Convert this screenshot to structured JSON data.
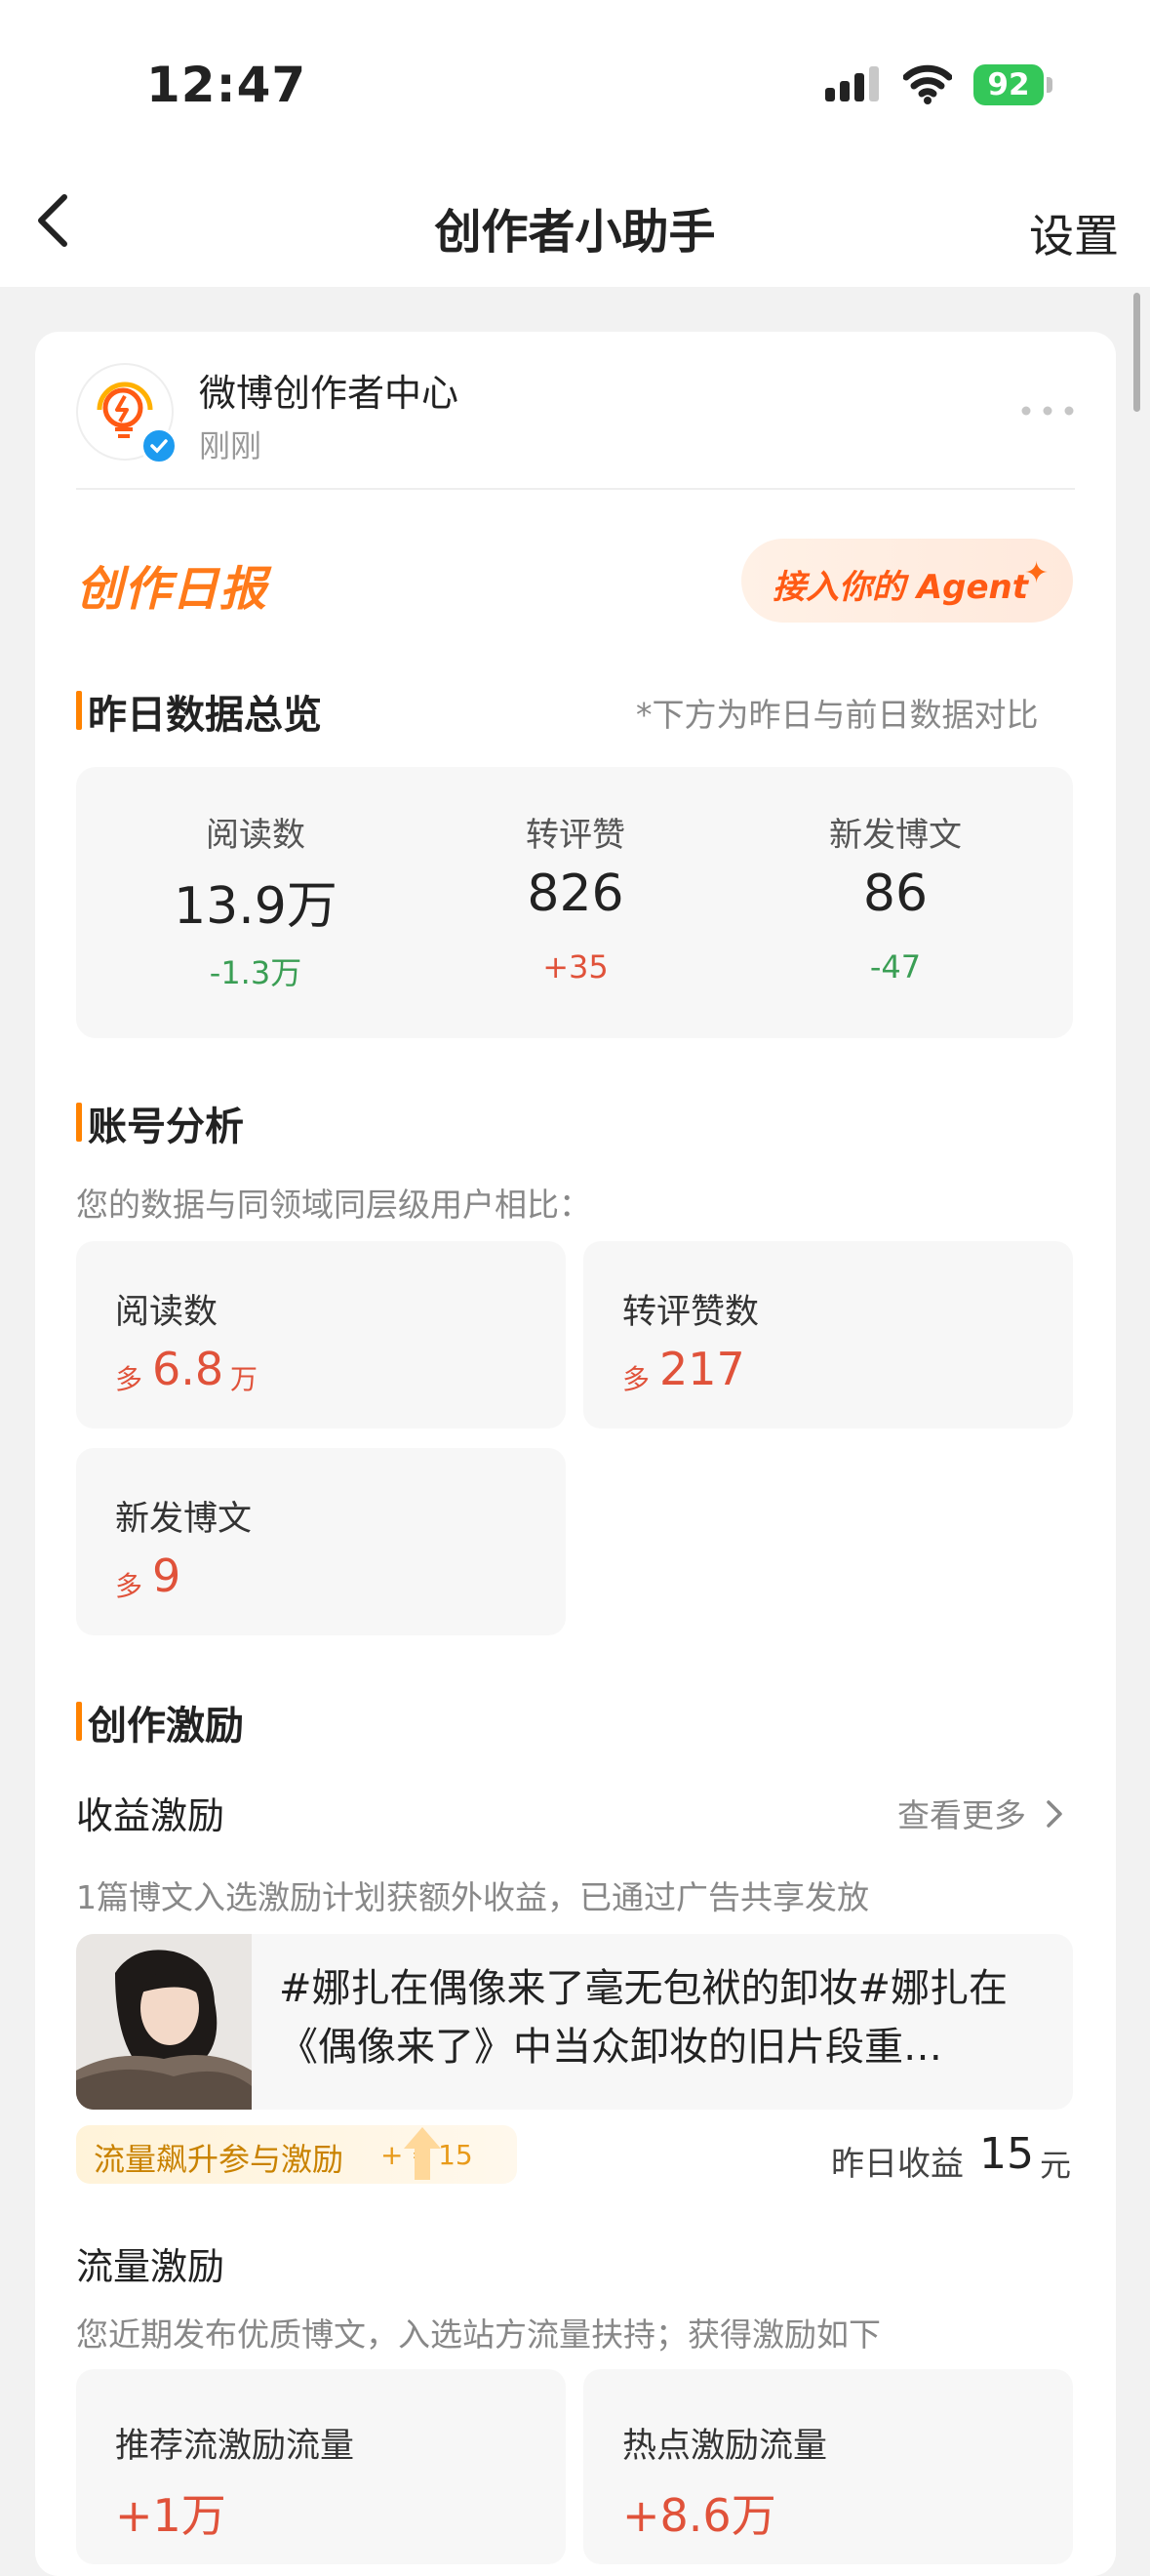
{
  "status_bar": {
    "time": "12:47",
    "battery": "92"
  },
  "nav": {
    "title": "创作者小助手",
    "settings": "设置"
  },
  "account": {
    "name": "微博创作者中心",
    "time": "刚刚"
  },
  "daily": {
    "title": "创作日报",
    "agent_button": "接入你的 Agent"
  },
  "overview": {
    "title": "昨日数据总览",
    "note": "*下方为昨日与前日数据对比",
    "items": [
      {
        "label": "阅读数",
        "value": "13.9万",
        "delta": "-1.3万"
      },
      {
        "label": "转评赞",
        "value": "826",
        "delta": "+35"
      },
      {
        "label": "新发博文",
        "value": "86",
        "delta": "-47"
      }
    ]
  },
  "analysis": {
    "title": "账号分析",
    "subtitle": "您的数据与同领域同层级用户相比：",
    "prefix": "多",
    "items": [
      {
        "label": "阅读数",
        "value": "6.8",
        "unit": "万"
      },
      {
        "label": "转评赞数",
        "value": "217",
        "unit": ""
      },
      {
        "label": "新发博文",
        "value": "9",
        "unit": ""
      }
    ]
  },
  "incentive": {
    "title": "创作激励",
    "revenue": {
      "title": "收益激励",
      "see_more": "查看更多",
      "desc": "1篇博文入选激励计划获额外收益，已通过广告共享发放",
      "post_text": "#娜扎在偶像来了毫无包袱的卸妆#娜扎在《偶像来了》中当众卸妆的旧片段重…",
      "tag": "流量飙升参与激励",
      "tag_bonus": "+ ¥ 15",
      "earnings_label": "昨日收益",
      "earnings_value": "15",
      "earnings_unit": "元"
    },
    "traffic": {
      "title": "流量激励",
      "desc": "您近期发布优质博文，入选站方流量扶持；获得激励如下",
      "items": [
        {
          "label": "推荐流激励流量",
          "value": "+1万"
        },
        {
          "label": "热点激励流量",
          "value": "+8.6万"
        }
      ]
    }
  }
}
